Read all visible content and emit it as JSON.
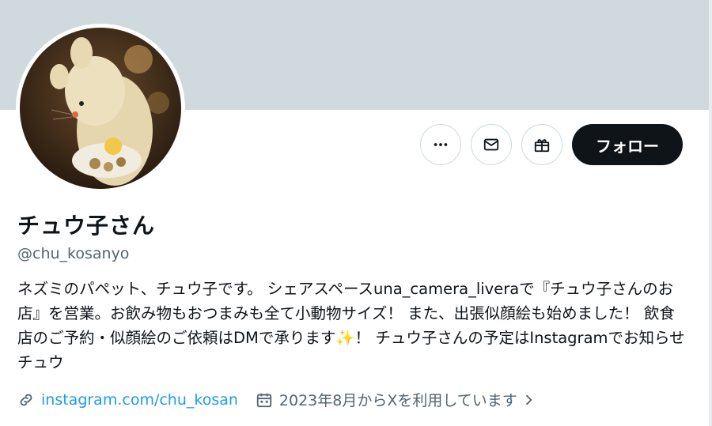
{
  "profile": {
    "display_name": "チュウ子さん",
    "handle": "@chu_kosanyo",
    "bio": "ネズミのパペット、チュウ子です。 シェアスペースuna_camera_liveraで『チュウ子さんのお店』を営業。お飲み物もおつまみも全て小動物サイズ！ また、出張似顔絵も始めました！ 飲食店のご予約・似顔絵のご依頼はDMで承ります✨！ チュウ子さんの予定はInstagramでお知らせチュウ",
    "website": "instagram.com/chu_kosan",
    "joined": "2023年8月からXを利用しています"
  },
  "actions": {
    "more_icon": "more-horizontal-icon",
    "message_icon": "envelope-icon",
    "gift_icon": "gift-icon",
    "follow_label": "フォロー"
  },
  "colors": {
    "banner": "#cfd9de",
    "link": "#1d9bf0",
    "secondary_text": "#536471",
    "follow_bg": "#0f1419"
  }
}
